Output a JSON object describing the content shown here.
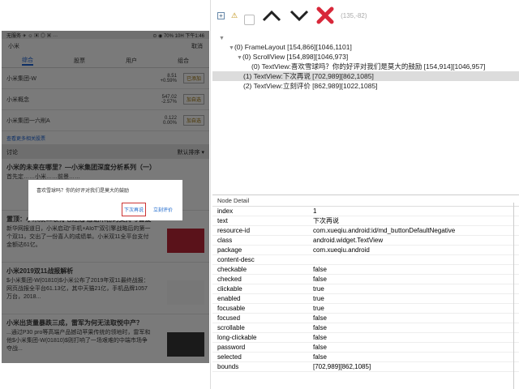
{
  "phone": {
    "status_left": "无服务 ✈ ☺ ▣ ◎ ▣ ···",
    "status_right": "⊙ ◉ 70% 10H 下午1:46",
    "search_value": "小米",
    "search_cancel": "取消",
    "tabs": [
      "综合",
      "股票",
      "用户",
      "组合"
    ],
    "stocks": [
      {
        "name": "小米集团-W",
        "price": "8.51",
        "change": "+0.59%",
        "action": "已添加"
      },
      {
        "name": "小米概念",
        "price": "547.02",
        "change": "-2.57%",
        "action": "加自选"
      },
      {
        "name": "小米集团一六削A",
        "price": "0.122",
        "change": "0.00%",
        "action": "加自选"
      }
    ],
    "more_link": "查看更多相关股票",
    "discussion_label": "讨论",
    "sort_label": "默认排序 ▾",
    "articles": [
      {
        "title": "小米的未来在哪里？—小米集团深度分析系列（一）",
        "snippet": "首先定……小米……前景……"
      },
      {
        "title": "置顶：小米双11取得七连冠 感谢米粉的支持与喜爱",
        "snippet": "新华网报道日，小米启动“手机+AIoT”双引擎战略后的第一个双11，交出了一份喜人的成绩单。小米双11全平台支付金额达61亿。"
      },
      {
        "title": "小米2019双11战报解析",
        "snippet": "$小米集团-W(01810)$小米公布了2019年双11最终战报：网页战报全平台61.13亿，其中天猫21亿，手机品牌1057万台，2018..."
      },
      {
        "title": "小米出货量暴跌三成，雷军为何无法取悦中产？",
        "snippet": "...通过P30 pro等高端产品撼动苹果传统的领地时，雷军和他$小米集团-W(01810)$则打响了一场艰难的中端市场争夺战..."
      }
    ],
    "dialog": {
      "message": "喜欢雪球吗？你的好评对我们是莫大的鼓励",
      "negative": "下次再说",
      "positive": "立刻评价"
    }
  },
  "toolbar": {
    "coords": "(135,-82)"
  },
  "tree": {
    "root": "",
    "nodes": [
      "(0) FrameLayout [154,866][1046,1101]",
      "(0) ScrollView [154,898][1046,973]",
      "(0) TextView:喜欢雪球吗？你的好评对我们是莫大的鼓励 [154,914][1046,957]",
      "(1) TextView:下次再说 [702,989][862,1085]",
      "(2) TextView:立刻评价 [862,989][1022,1085]"
    ]
  },
  "detail": {
    "title": "Node Detail",
    "rows": [
      [
        "index",
        "1"
      ],
      [
        "text",
        "下次再说"
      ],
      [
        "resource-id",
        "com.xueqiu.android:id/md_buttonDefaultNegative"
      ],
      [
        "class",
        "android.widget.TextView"
      ],
      [
        "package",
        "com.xueqiu.android"
      ],
      [
        "content-desc",
        ""
      ],
      [
        "checkable",
        "false"
      ],
      [
        "checked",
        "false"
      ],
      [
        "clickable",
        "true"
      ],
      [
        "enabled",
        "true"
      ],
      [
        "focusable",
        "true"
      ],
      [
        "focused",
        "false"
      ],
      [
        "scrollable",
        "false"
      ],
      [
        "long-clickable",
        "false"
      ],
      [
        "password",
        "false"
      ],
      [
        "selected",
        "false"
      ],
      [
        "bounds",
        "[702,989][862,1085]"
      ]
    ]
  }
}
